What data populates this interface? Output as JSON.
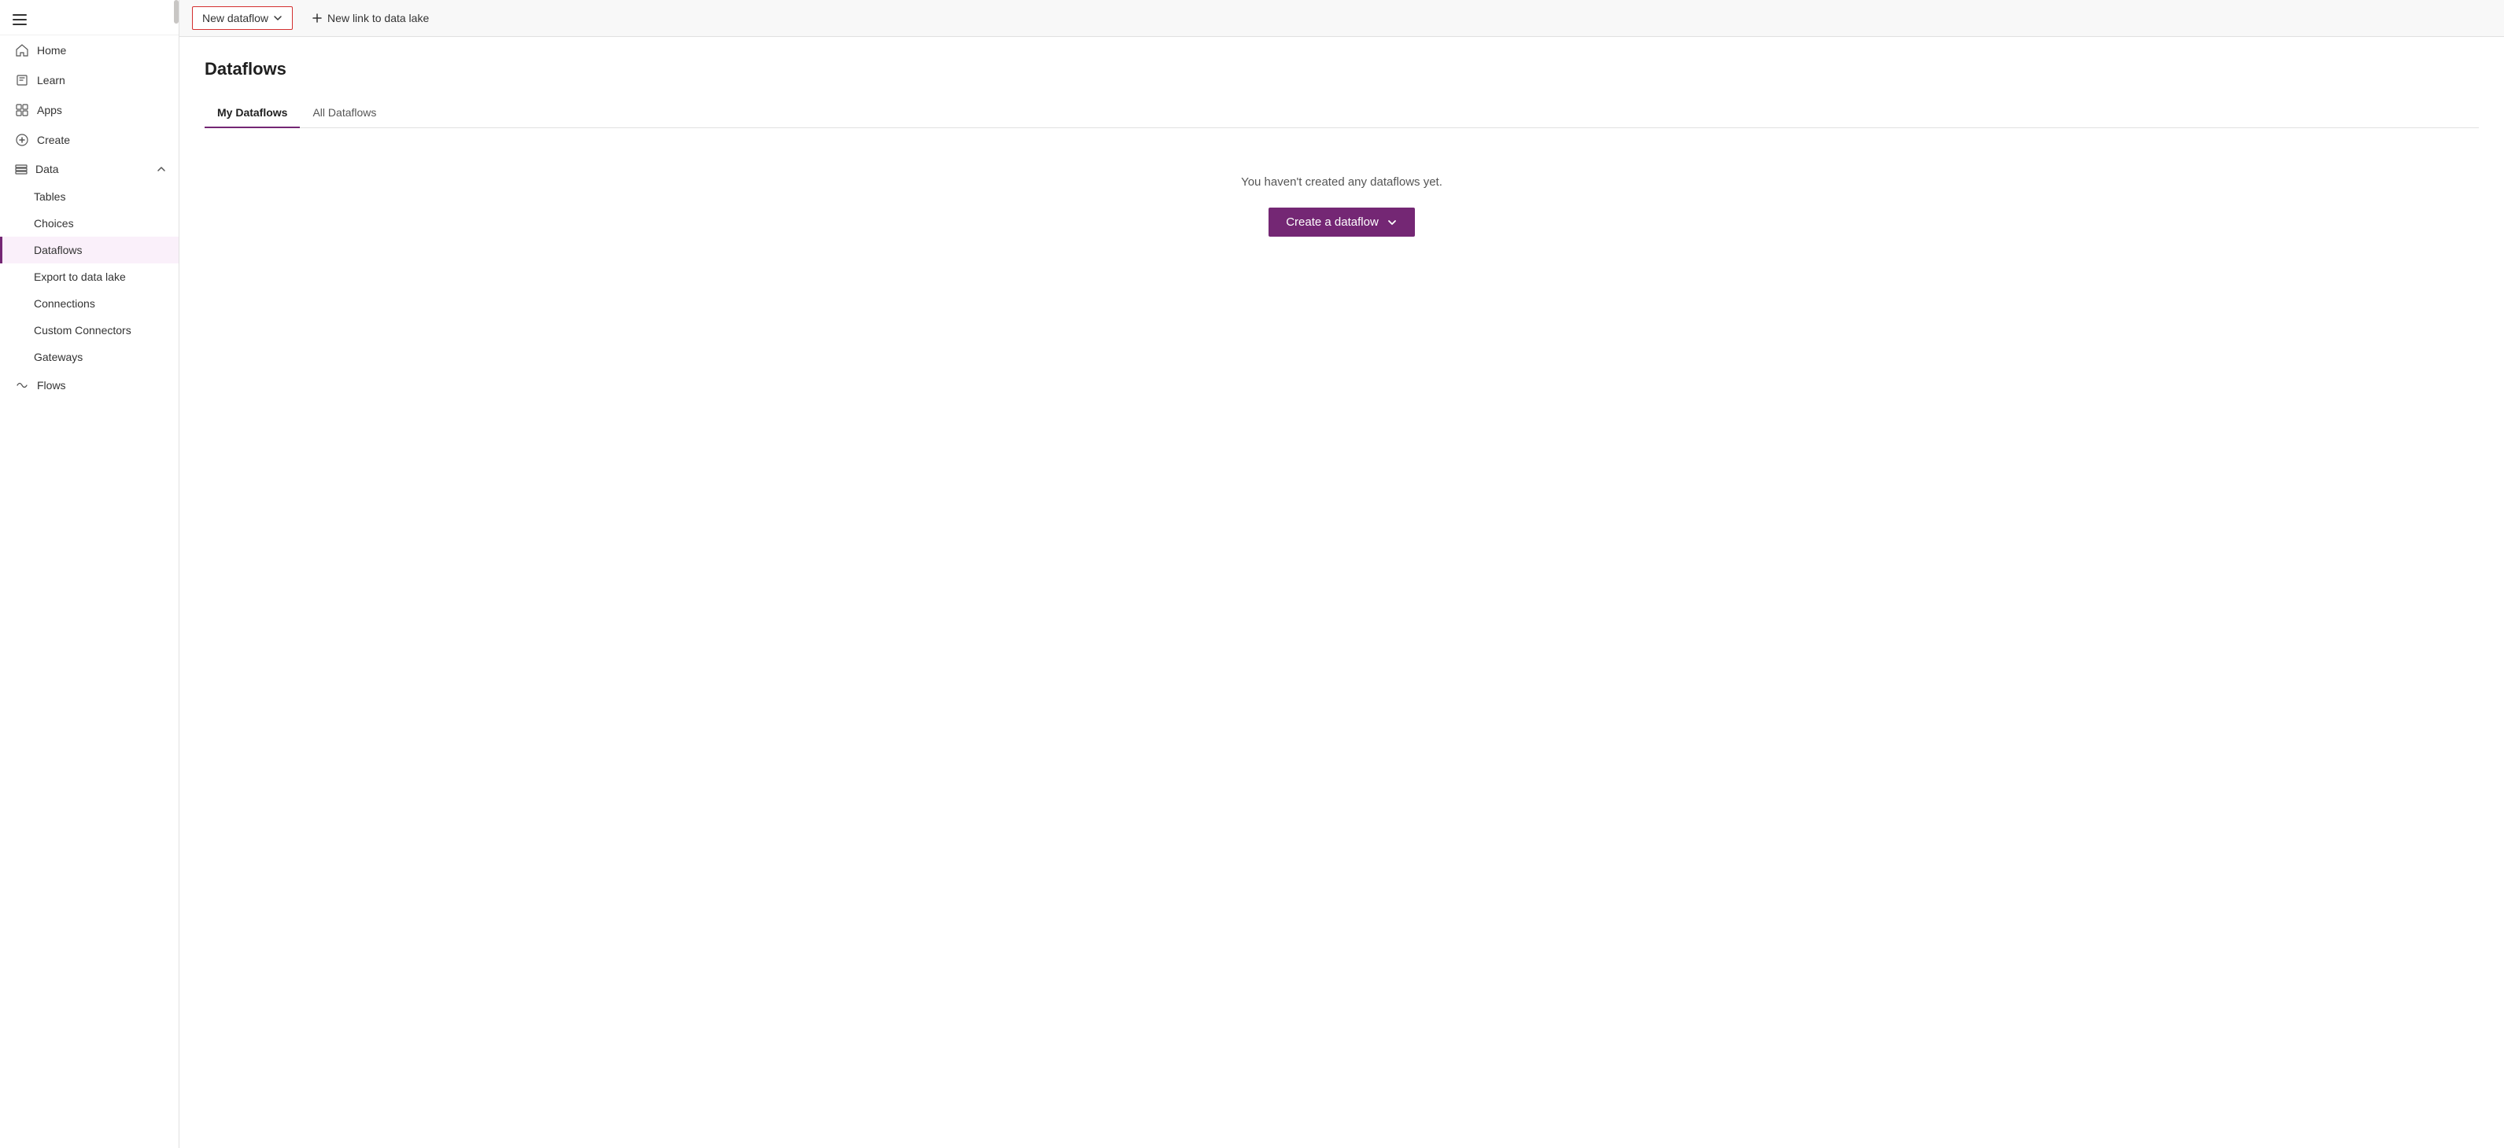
{
  "sidebar": {
    "hamburger_label": "Menu",
    "nav_items": [
      {
        "id": "home",
        "label": "Home",
        "icon": "home-icon"
      },
      {
        "id": "learn",
        "label": "Learn",
        "icon": "learn-icon"
      },
      {
        "id": "apps",
        "label": "Apps",
        "icon": "apps-icon"
      },
      {
        "id": "create",
        "label": "Create",
        "icon": "create-icon"
      }
    ],
    "data_section": {
      "label": "Data",
      "icon": "data-icon",
      "expanded": true,
      "sub_items": [
        {
          "id": "tables",
          "label": "Tables"
        },
        {
          "id": "choices",
          "label": "Choices"
        },
        {
          "id": "dataflows",
          "label": "Dataflows",
          "active": true
        },
        {
          "id": "export-to-data-lake",
          "label": "Export to data lake"
        },
        {
          "id": "connections",
          "label": "Connections"
        },
        {
          "id": "custom-connectors",
          "label": "Custom Connectors"
        },
        {
          "id": "gateways",
          "label": "Gateways"
        }
      ]
    },
    "flows_item": {
      "id": "flows",
      "label": "Flows",
      "icon": "flows-icon"
    }
  },
  "toolbar": {
    "new_dataflow_label": "New dataflow",
    "new_link_label": "New link to data lake"
  },
  "main": {
    "page_title": "Dataflows",
    "tabs": [
      {
        "id": "my-dataflows",
        "label": "My Dataflows",
        "active": true
      },
      {
        "id": "all-dataflows",
        "label": "All Dataflows",
        "active": false
      }
    ],
    "empty_state_text": "You haven't created any dataflows yet.",
    "create_dataflow_label": "Create a dataflow"
  }
}
